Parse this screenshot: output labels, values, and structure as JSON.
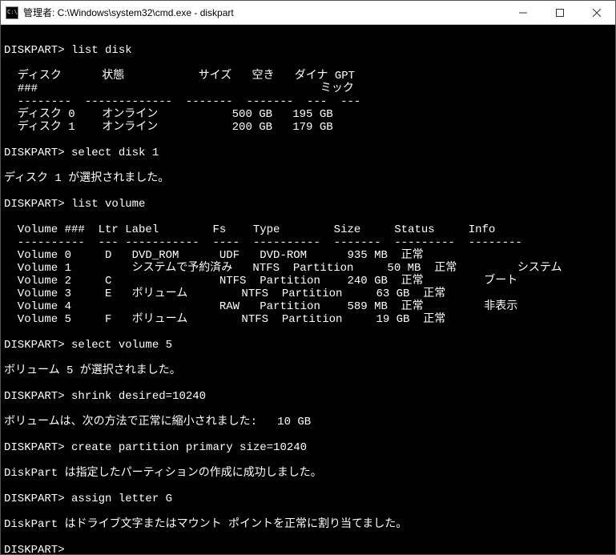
{
  "titlebar": {
    "title": "管理者: C:\\Windows\\system32\\cmd.exe - diskpart"
  },
  "prompts": {
    "p1": "DISKPART> ",
    "cmd_list_disk": "list disk",
    "cmd_select_disk": "select disk 1",
    "cmd_list_volume": "list volume",
    "cmd_select_vol": "select volume 5",
    "cmd_shrink": "shrink desired=10240",
    "cmd_create": "create partition primary size=10240",
    "cmd_assign": "assign letter G"
  },
  "disk_header": {
    "col1": "ディスク",
    "col1b": "###",
    "col2": "状態",
    "col3": "サイズ",
    "col4": "空き",
    "col5": "ダイナ",
    "col5b": "ミック",
    "col6": "GPT"
  },
  "disk_rule": "  --------  -------------  -------  -------  ---  ---",
  "disks": {
    "d0": "  ディスク 0    オンライン           500 GB   195 GB",
    "d1": "  ディスク 1    オンライン           200 GB   179 GB"
  },
  "msg_disk_selected": "ディスク 1 が選択されました。",
  "vol_header": "  Volume ###  Ltr Label        Fs    Type        Size     Status     Info",
  "vol_rule": "  ----------  --- -----------  ----  ----------  -------  ---------  --------",
  "volumes": {
    "v0": "  Volume 0     D   DVD_ROM      UDF   DVD-ROM      935 MB  正常",
    "v1": "  Volume 1         システムで予約済み   NTFS  Partition     50 MB  正常         システム",
    "v2": "  Volume 2     C                NTFS  Partition    240 GB  正常         ブート",
    "v3": "  Volume 3     E   ボリューム        NTFS  Partition     63 GB  正常",
    "v4": "  Volume 4                      RAW   Partition    589 MB  正常         非表示",
    "v5": "  Volume 5     F   ボリューム        NTFS  Partition     19 GB  正常"
  },
  "msg_vol_selected": "ボリューム 5 が選択されました。",
  "msg_shrink": "ボリュームは、次の方法で正常に縮小されました:   10 GB",
  "msg_create": "DiskPart は指定したパーティションの作成に成功しました。",
  "msg_assign": "DiskPart はドライブ文字またはマウント ポイントを正常に割り当てました。",
  "chart_data": {
    "type": "table",
    "disks": [
      {
        "id": "ディスク 0",
        "status": "オンライン",
        "size": "500 GB",
        "free": "195 GB"
      },
      {
        "id": "ディスク 1",
        "status": "オンライン",
        "size": "200 GB",
        "free": "179 GB"
      }
    ],
    "volumes": [
      {
        "num": 0,
        "ltr": "D",
        "label": "DVD_ROM",
        "fs": "UDF",
        "type": "DVD-ROM",
        "size": "935 MB",
        "status": "正常",
        "info": ""
      },
      {
        "num": 1,
        "ltr": "",
        "label": "システムで予約済み",
        "fs": "NTFS",
        "type": "Partition",
        "size": "50 MB",
        "status": "正常",
        "info": "システム"
      },
      {
        "num": 2,
        "ltr": "C",
        "label": "",
        "fs": "NTFS",
        "type": "Partition",
        "size": "240 GB",
        "status": "正常",
        "info": "ブート"
      },
      {
        "num": 3,
        "ltr": "E",
        "label": "ボリューム",
        "fs": "NTFS",
        "type": "Partition",
        "size": "63 GB",
        "status": "正常",
        "info": ""
      },
      {
        "num": 4,
        "ltr": "",
        "label": "",
        "fs": "RAW",
        "type": "Partition",
        "size": "589 MB",
        "status": "正常",
        "info": "非表示"
      },
      {
        "num": 5,
        "ltr": "F",
        "label": "ボリューム",
        "fs": "NTFS",
        "type": "Partition",
        "size": "19 GB",
        "status": "正常",
        "info": ""
      }
    ]
  }
}
